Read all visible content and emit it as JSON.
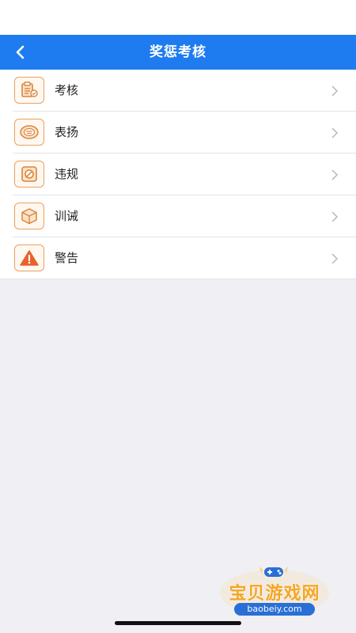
{
  "header": {
    "title": "奖惩考核",
    "back_icon": "chevron-left-icon",
    "background": "#1e7cf0"
  },
  "menu": {
    "items": [
      {
        "label": "考核",
        "icon": "clipboard-check-icon"
      },
      {
        "label": "表扬",
        "icon": "praise-badge-icon"
      },
      {
        "label": "违规",
        "icon": "prohibited-icon"
      },
      {
        "label": "训诫",
        "icon": "box-icon"
      },
      {
        "label": "警告",
        "icon": "warning-triangle-icon"
      }
    ],
    "accent": "#e9a160"
  },
  "watermark": {
    "text": "宝贝游戏网",
    "url": "baobeiy.com"
  }
}
